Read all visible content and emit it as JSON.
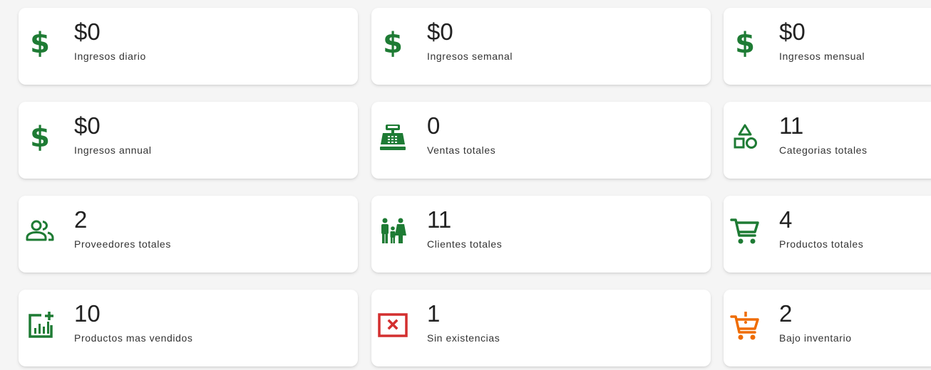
{
  "colors": {
    "green": "#1e7b34",
    "red": "#d32f2f",
    "orange": "#ef6c00"
  },
  "cards": [
    {
      "value": "$0",
      "label": "Ingresos diario",
      "icon": "dollar-icon"
    },
    {
      "value": "$0",
      "label": "Ingresos semanal",
      "icon": "dollar-icon"
    },
    {
      "value": "$0",
      "label": "Ingresos mensual",
      "icon": "dollar-icon"
    },
    {
      "value": "$0",
      "label": "Ingresos annual",
      "icon": "dollar-icon"
    },
    {
      "value": "0",
      "label": "Ventas totales",
      "icon": "cash-register-icon"
    },
    {
      "value": "11",
      "label": "Categorias totales",
      "icon": "shapes-icon"
    },
    {
      "value": "2",
      "label": "Proveedores totales",
      "icon": "people-icon"
    },
    {
      "value": "11",
      "label": "Clientes totales",
      "icon": "family-icon"
    },
    {
      "value": "4",
      "label": "Productos totales",
      "icon": "cart-icon"
    },
    {
      "value": "10",
      "label": "Productos mas vendidos",
      "icon": "chart-add-icon"
    },
    {
      "value": "1",
      "label": "Sin existencias",
      "icon": "close-box-icon"
    },
    {
      "value": "2",
      "label": "Bajo inventario",
      "icon": "cart-alert-icon"
    }
  ]
}
